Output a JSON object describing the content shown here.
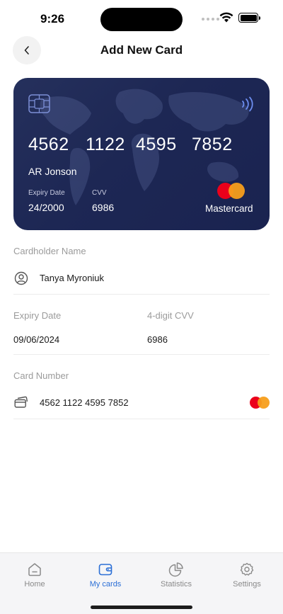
{
  "status_bar": {
    "time": "9:26"
  },
  "header": {
    "title": "Add New Card",
    "back_icon": "chevron-left-icon"
  },
  "card": {
    "number_groups": [
      "4562",
      "1122",
      "4595",
      "7852"
    ],
    "holder": "AR Jonson",
    "expiry_label": "Expiry Date",
    "expiry_value": "24/2000",
    "cvv_label": "CVV",
    "cvv_value": "6986",
    "brand": "Mastercard",
    "background_color": "#1d2754"
  },
  "form": {
    "cardholder_label": "Cardholder Name",
    "cardholder_value": "Tanya Myroniuk",
    "expiry_label": "Expiry Date",
    "expiry_value": "09/06/2024",
    "cvv_label": "4-digit CVV",
    "cvv_value": "6986",
    "card_number_label": "Card Number",
    "card_number_value": "4562 1122 4595 7852"
  },
  "bottom_nav": {
    "active": "My cards",
    "active_color": "#2b6fd6",
    "items": [
      {
        "label": "Home",
        "icon": "home-icon"
      },
      {
        "label": "My cards",
        "icon": "wallet-icon"
      },
      {
        "label": "Statistics",
        "icon": "pie-chart-icon"
      },
      {
        "label": "Settings",
        "icon": "gear-icon"
      }
    ]
  }
}
